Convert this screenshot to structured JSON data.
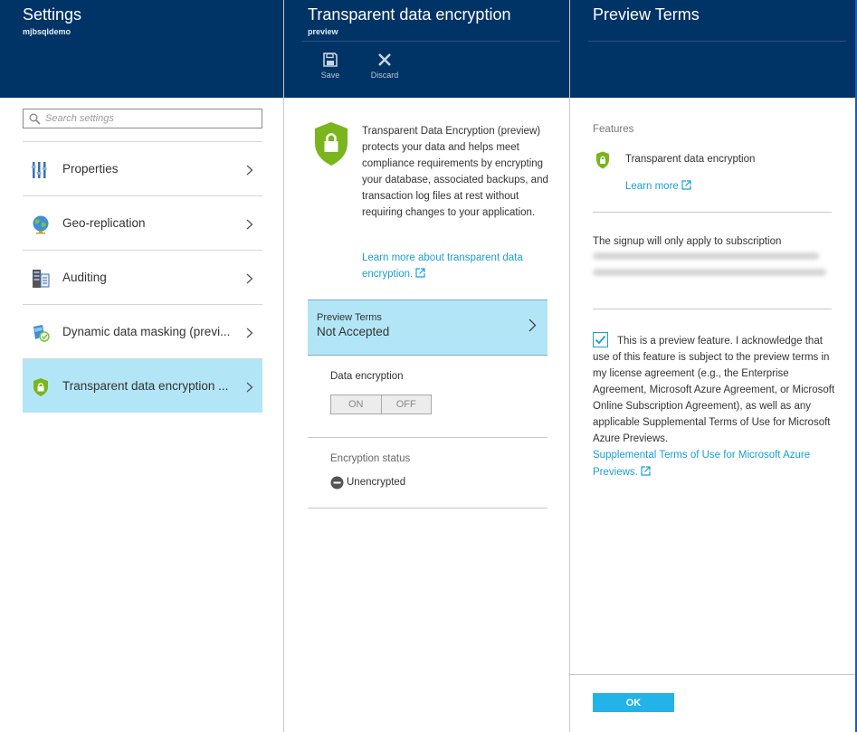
{
  "settings_blade": {
    "title": "Settings",
    "subtitle": "mjbsqldemo",
    "search_placeholder": "Search settings",
    "items": [
      {
        "label": "Properties",
        "icon": "properties-icon"
      },
      {
        "label": "Geo-replication",
        "icon": "globe-icon"
      },
      {
        "label": "Auditing",
        "icon": "auditing-icon"
      },
      {
        "label": "Dynamic data masking (previ...",
        "icon": "data-masking-icon"
      },
      {
        "label": "Transparent data encryption ...",
        "icon": "shield-lock-icon",
        "active": true
      }
    ]
  },
  "tde_blade": {
    "title": "Transparent data encryption",
    "subtitle": "preview",
    "commands": {
      "save": "Save",
      "discard": "Discard"
    },
    "description": "Transparent Data Encryption (preview) protects your data and helps meet compliance requirements by encrypting your database, associated backups, and transaction log files at rest without requiring changes to your application.",
    "learn_more": "Learn more about transparent data encryption.",
    "preview_terms_label": "Preview Terms",
    "preview_terms_value": "Not Accepted",
    "data_encryption_label": "Data encryption",
    "toggle_on": "ON",
    "toggle_off": "OFF",
    "encryption_status_label": "Encryption status",
    "encryption_status_value": "Unencrypted"
  },
  "preview_blade": {
    "title": "Preview Terms",
    "features_label": "Features",
    "feature_name": "Transparent data encryption",
    "feature_learn_more": "Learn more",
    "signup_text": "The signup will only apply to subscription",
    "acknowledged": true,
    "ack_text": "This is a preview feature. I acknowledge that use of this feature is subject to the preview terms in my license agreement (e.g., the Enterprise Agreement, Microsoft Azure Agreement, or Microsoft Online Subscription Agreement), as well as any applicable Supplemental Terms of Use for Microsoft Azure Previews.",
    "ack_link": "Supplemental Terms of Use for Microsoft Azure Previews.",
    "ok_label": "OK"
  },
  "colors": {
    "header": "#003366",
    "active": "#b2e6f6",
    "link": "#1a9fd5",
    "ok_button": "#23b3e8",
    "shield": "#7ab51d"
  }
}
